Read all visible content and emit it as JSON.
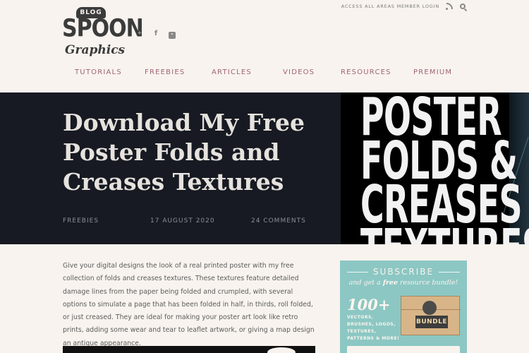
{
  "brand": {
    "badge": "BLOG",
    "name": "SPOON",
    "tagline": "Graphics"
  },
  "social": {
    "twitter": "twitter-icon",
    "facebook": "facebook-icon",
    "youtube": "youtube-icon"
  },
  "topbar": {
    "login": "ACCESS ALL AREAS MEMBER LOGIN",
    "rss": "rss-icon",
    "search": "search-icon"
  },
  "nav": [
    "TUTORIALS",
    "FREEBIES",
    "ARTICLES",
    "VIDEOS",
    "RESOURCES",
    "PREMIUM"
  ],
  "hero": {
    "title": "Download My Free Poster Folds and Creases Textures",
    "category": "FREEBIES",
    "date": "17 AUGUST 2020",
    "comments": "24 COMMENTS",
    "poster_lines": [
      "POSTER",
      "FOLDS &",
      "CREASES",
      "TEXTURES"
    ]
  },
  "article": {
    "intro": "Give your digital designs the look of a real printed poster with my free collection of folds and creases textures. These textures feature detailed damage lines from the paper being folded and crumpled, with several options to simulate a page that has been folded in half, in thirds, roll folded, or just creased. They are ideal for making your poster art look like retro prints, adding some wear and tear to leaflet artwork, or giving a map design an antique appearance."
  },
  "subscribe": {
    "title": "SUBSCRIBE",
    "line_before": "and get a ",
    "line_em": "free",
    "line_after": " resource bundle!",
    "count": "100+",
    "assets": "VECTORS, BRUSHES, LOGOS, TEXTURES, PATTERNS & MORE!",
    "bundle": "BUNDLE"
  },
  "colors": {
    "accent": "#a0637a",
    "hero_bg": "#171a22",
    "widget_bg": "#8cc7c3",
    "page_bg": "#f8f3ee"
  }
}
